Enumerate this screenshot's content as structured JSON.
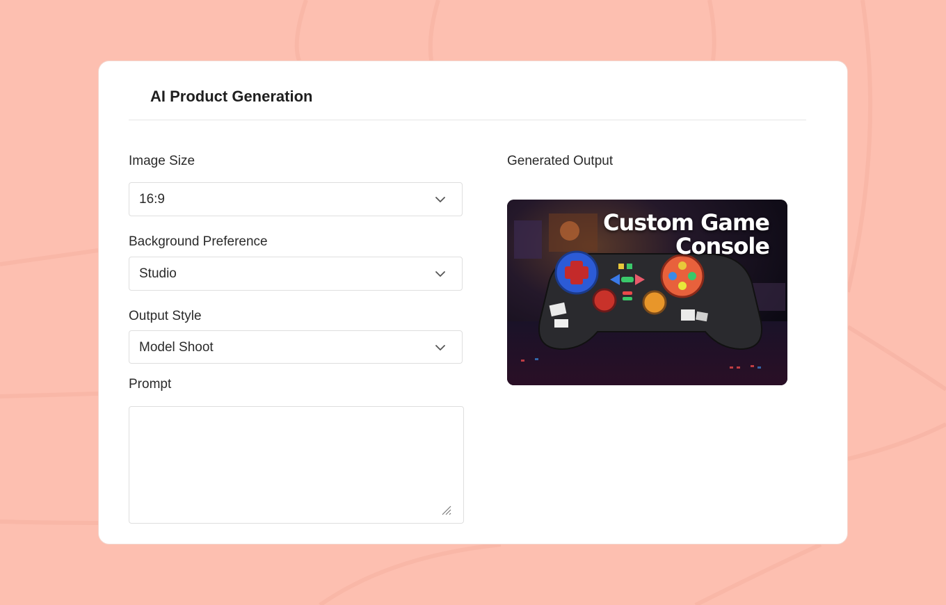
{
  "panel": {
    "title": "AI Product Generation"
  },
  "form": {
    "image_size": {
      "label": "Image Size",
      "value": "16:9"
    },
    "background": {
      "label": "Background Preference",
      "value": "Studio"
    },
    "output_style": {
      "label": "Output Style",
      "value": "Model Shoot"
    },
    "prompt": {
      "label": "Prompt",
      "value": "",
      "placeholder": ""
    }
  },
  "output": {
    "label": "Generated Output",
    "image_caption_line1": "Custom Game",
    "image_caption_line2": "Console",
    "image_subject": "game-controller-image"
  },
  "colors": {
    "page_background": "#fdbfb0",
    "card_background": "#ffffff"
  }
}
